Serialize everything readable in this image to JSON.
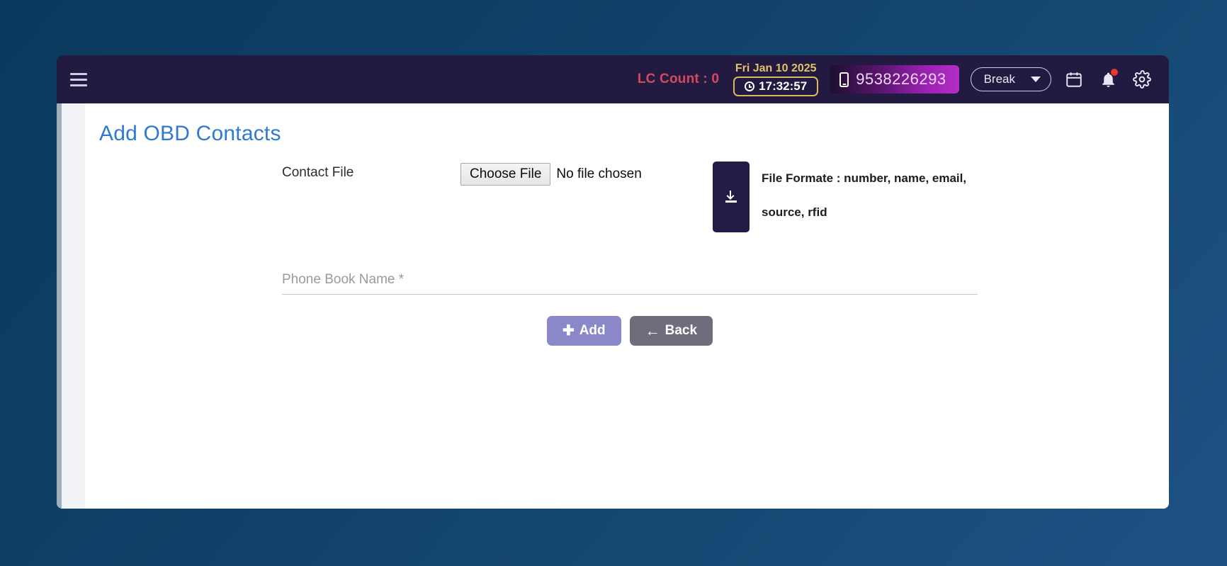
{
  "header": {
    "menu_icon": "hamburger-icon",
    "lc_count_label": "LC Count : 0",
    "date": "Fri Jan 10 2025",
    "time": "17:32:57",
    "phone_number": "9538226293",
    "status_select_value": "Break",
    "calendar_icon": "calendar-icon",
    "notification_icon": "bell-icon",
    "settings_icon": "gear-icon",
    "colors": {
      "bar_bg": "#231a41",
      "lc_count": "#d4495e",
      "date_gold": "#e3c168",
      "phone_badge_start": "#1d0f2e",
      "phone_badge_end": "#b32ec4",
      "notification_dot": "#e8372b"
    }
  },
  "page": {
    "title": "Add OBD Contacts",
    "title_color": "#2f7ad0"
  },
  "form": {
    "contact_file_label": "Contact File",
    "choose_file_button": "Choose File",
    "file_status_text": "No file chosen",
    "download_icon": "download-icon",
    "file_format_note": "File Formate : number, name, email, source, rfid",
    "phone_book_placeholder": "Phone Book Name *",
    "phone_book_value": "",
    "add_button": "Add",
    "add_button_icon": "plus-icon",
    "add_button_color": "#8b88c9",
    "back_button": "Back",
    "back_button_icon": "arrow-left-icon",
    "back_button_color": "#6d6d7c"
  }
}
